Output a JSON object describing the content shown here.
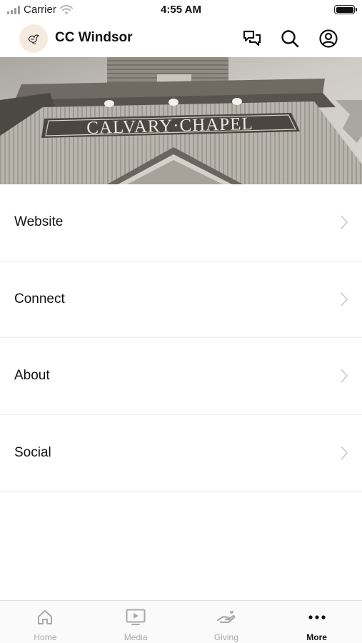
{
  "status_bar": {
    "carrier": "Carrier",
    "time": "4:55 AM"
  },
  "header": {
    "title": "CC Windsor"
  },
  "hero": {
    "sign_text": "CALVARY·CHAPEL"
  },
  "menu": {
    "items": [
      {
        "label": "Website"
      },
      {
        "label": "Connect"
      },
      {
        "label": "About"
      },
      {
        "label": "Social"
      }
    ]
  },
  "tab_bar": {
    "tabs": [
      {
        "label": "Home",
        "icon": "home-icon"
      },
      {
        "label": "Media",
        "icon": "media-icon"
      },
      {
        "label": "Giving",
        "icon": "giving-icon"
      },
      {
        "label": "More",
        "icon": "more-icon",
        "active": true
      }
    ]
  }
}
